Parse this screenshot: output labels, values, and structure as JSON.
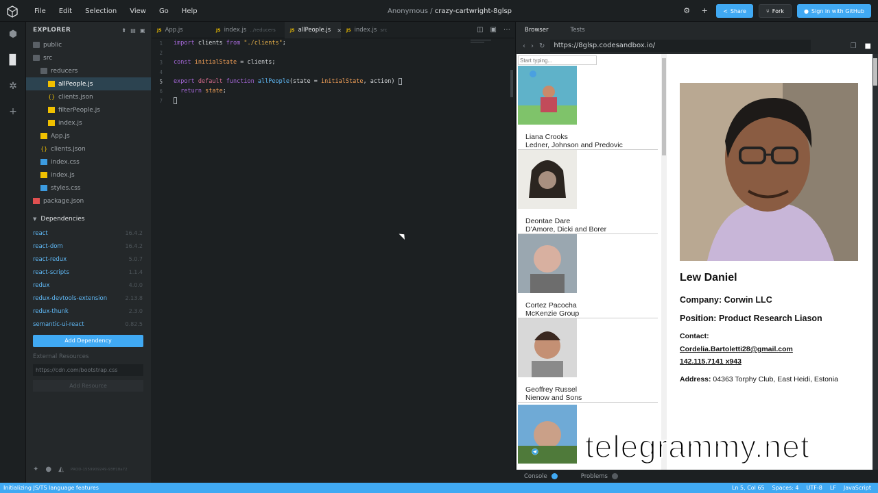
{
  "menu": {
    "items": [
      "File",
      "Edit",
      "Selection",
      "View",
      "Go",
      "Help"
    ]
  },
  "header": {
    "owner": "Anonymous",
    "separator": " / ",
    "sandbox": "crazy-cartwright-8glsp",
    "share_label": "Share",
    "fork_label": "Fork",
    "signin_label": "Sign in with GitHub"
  },
  "explorer": {
    "title": "EXPLORER",
    "tree": [
      {
        "label": "public",
        "type": "folder",
        "indent": 1
      },
      {
        "label": "src",
        "type": "folder",
        "indent": 1
      },
      {
        "label": "reducers",
        "type": "folder",
        "indent": 2
      },
      {
        "label": "allPeople.js",
        "type": "js",
        "indent": 3,
        "active": true
      },
      {
        "label": "clients.json",
        "type": "json",
        "indent": 3
      },
      {
        "label": "filterPeople.js",
        "type": "js",
        "indent": 3
      },
      {
        "label": "index.js",
        "type": "js",
        "indent": 3
      },
      {
        "label": "App.js",
        "type": "js",
        "indent": 2
      },
      {
        "label": "clients.json",
        "type": "json",
        "indent": 2
      },
      {
        "label": "index.css",
        "type": "css",
        "indent": 2
      },
      {
        "label": "index.js",
        "type": "js",
        "indent": 2
      },
      {
        "label": "styles.css",
        "type": "css",
        "indent": 2
      },
      {
        "label": "package.json",
        "type": "pkg",
        "indent": 1
      }
    ],
    "dependencies_title": "Dependencies",
    "dependencies": [
      {
        "name": "react",
        "version": "16.4.2"
      },
      {
        "name": "react-dom",
        "version": "16.4.2"
      },
      {
        "name": "react-redux",
        "version": "5.0.7"
      },
      {
        "name": "react-scripts",
        "version": "1.1.4"
      },
      {
        "name": "redux",
        "version": "4.0.0"
      },
      {
        "name": "redux-devtools-extension",
        "version": "2.13.8"
      },
      {
        "name": "redux-thunk",
        "version": "2.3.0"
      },
      {
        "name": "semantic-ui-react",
        "version": "0.82.5"
      }
    ],
    "add_dependency_label": "Add Dependency",
    "external_resources_title": "External Resources",
    "resource_placeholder": "https://cdn.com/bootstrap.css",
    "add_resource_label": "Add Resource",
    "build_id": "PROD-1559909249-93ff18a72"
  },
  "editor": {
    "tabs": [
      {
        "label": "App.js",
        "dir": ""
      },
      {
        "label": "index.js",
        "dir": "../reducers"
      },
      {
        "label": "allPeople.js",
        "dir": "",
        "active": true
      },
      {
        "label": "index.js",
        "dir": "src"
      }
    ]
  },
  "browser": {
    "tab_browser": "Browser",
    "tab_tests": "Tests",
    "url": "https://8glsp.codesandbox.io/",
    "search_placeholder": "Start typing...",
    "people": [
      {
        "name": "Liana Crooks",
        "company": "Ledner, Johnson and Predovic"
      },
      {
        "name": "Deontae Dare",
        "company": "D'Amore, Dicki and Borer"
      },
      {
        "name": "Cortez Pacocha",
        "company": "McKenzie Group"
      },
      {
        "name": "Geoffrey Russel",
        "company": "Nienow and Sons"
      }
    ],
    "detail": {
      "name": "Lew Daniel",
      "company": "Company: Corwin LLC",
      "position": "Position: Product Research Liason",
      "contact_label": "Contact:",
      "email": "Cordelia.Bartoletti28@gmail.com",
      "phone": "142.115.7141 x943",
      "address_label": "Address:",
      "address": " 04363 Torphy Club, East Heidi, Estonia"
    },
    "console_label": "Console",
    "problems_label": "Problems"
  },
  "watermark": "telegrammy.net",
  "status": {
    "left": "Initializing JS/TS language features",
    "position": "Ln 5, Col 65",
    "spaces": "Spaces: 4",
    "encoding": "UTF-8",
    "eol": "LF",
    "language": "JavaScript"
  }
}
